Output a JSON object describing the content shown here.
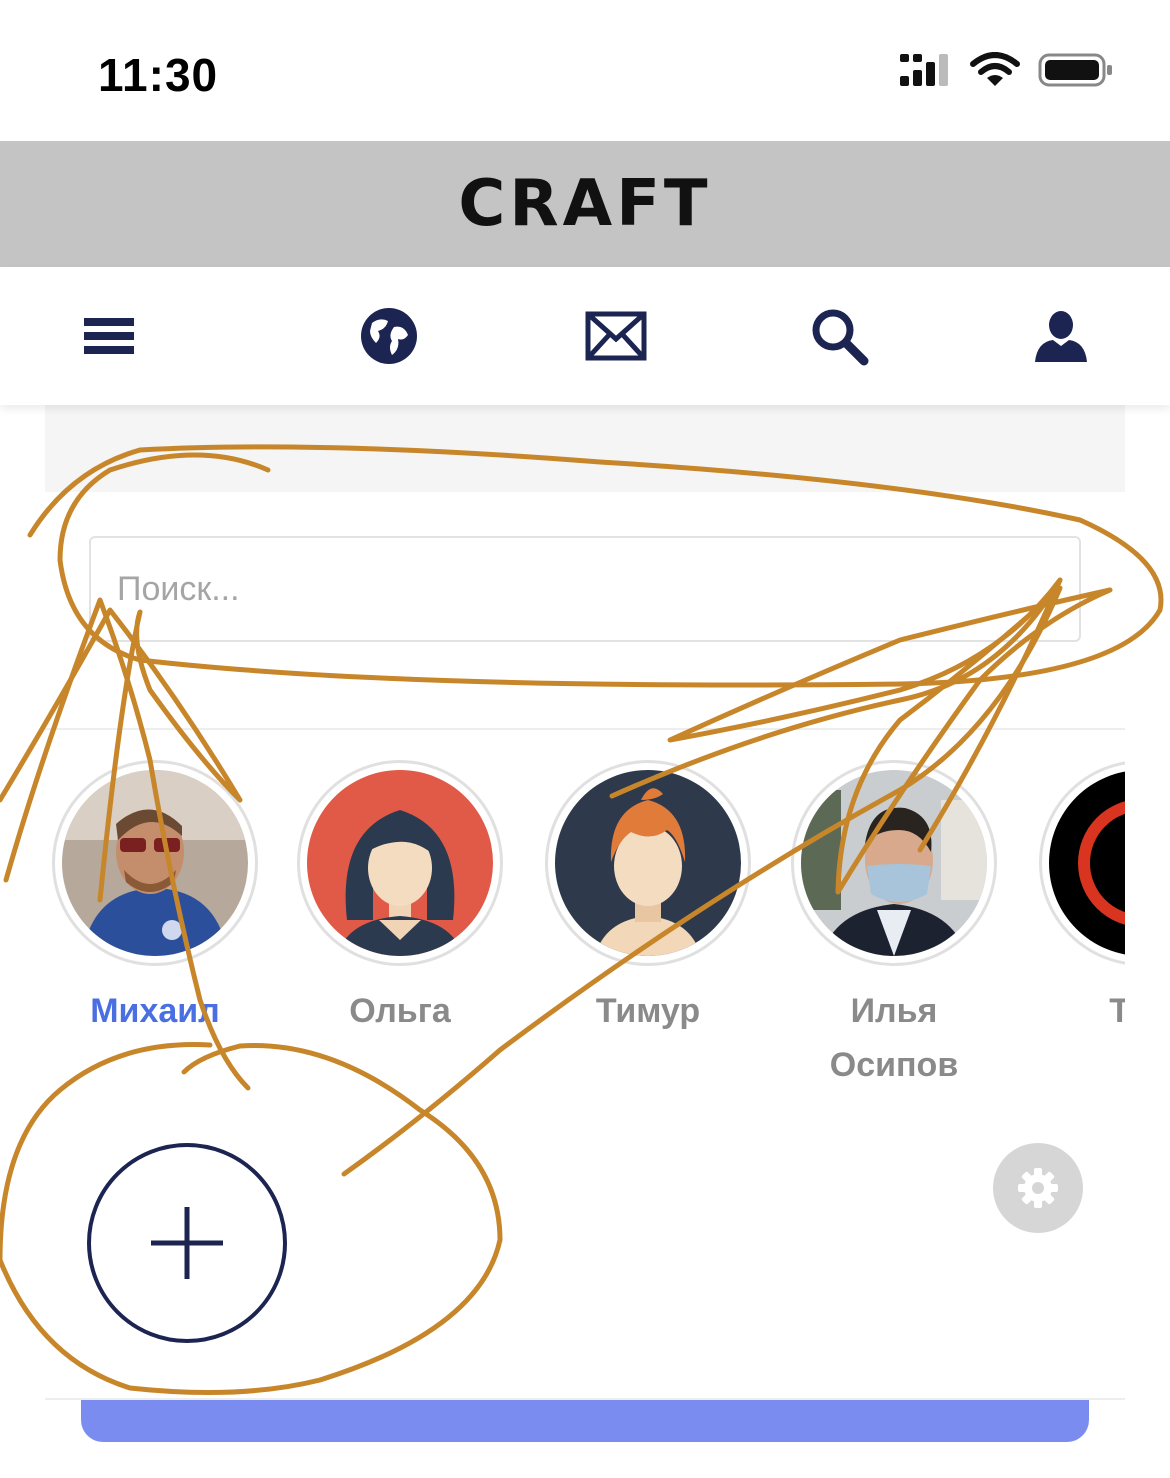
{
  "status_bar": {
    "time": "11:30",
    "icons": [
      "signal-icon",
      "wifi-icon",
      "battery-icon"
    ]
  },
  "brand": {
    "logo_text": "CRAFT"
  },
  "nav": {
    "items": [
      "menu-icon",
      "globe-icon",
      "mail-icon",
      "search-icon",
      "user-icon"
    ]
  },
  "search": {
    "placeholder": "Поиск...",
    "value": ""
  },
  "contacts": [
    {
      "name": "Михаил",
      "active": true
    },
    {
      "name": "Ольга",
      "active": false
    },
    {
      "name": "Тимур",
      "active": false
    },
    {
      "name": "Илья Осипов",
      "active": false
    },
    {
      "name": "Тим",
      "active": false
    }
  ],
  "actions": {
    "add_icon": "plus-icon",
    "settings_icon": "gear-icon"
  },
  "colors": {
    "brand_bar": "#c4c4c4",
    "navy": "#1c2452",
    "active_name": "#4a6fe3",
    "bottom_button": "#7a8cf0",
    "annotation": "#c8862a"
  }
}
